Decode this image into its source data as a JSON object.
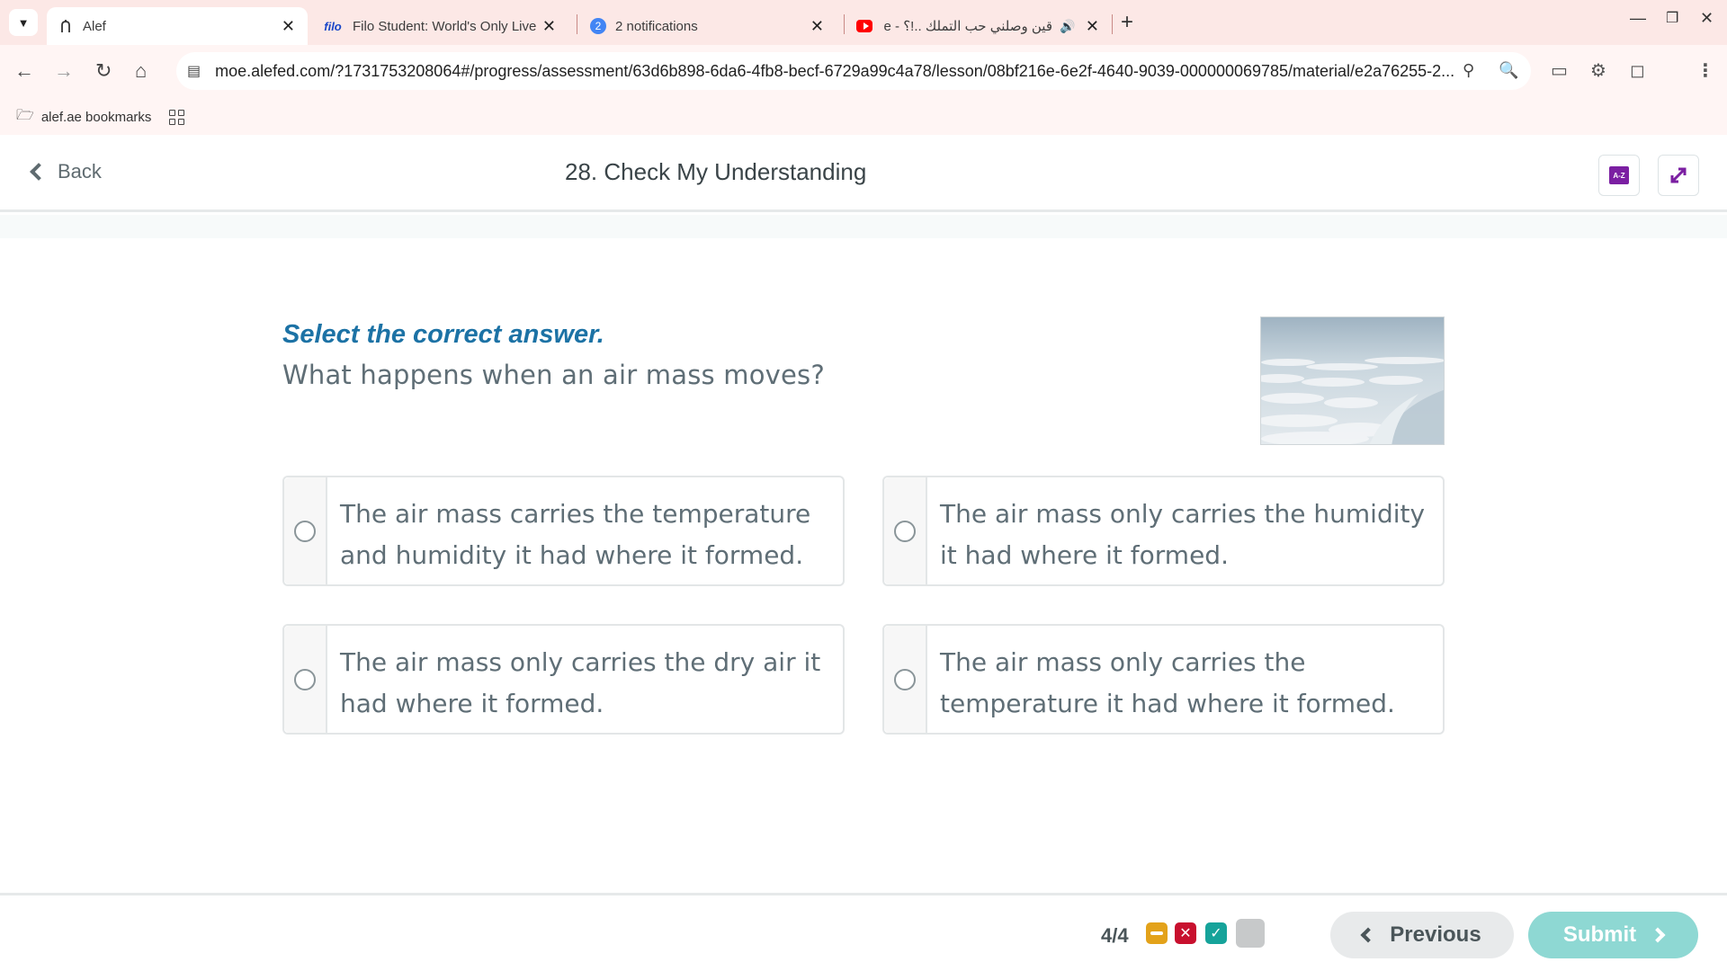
{
  "browser": {
    "tabs": [
      {
        "title": "Alef",
        "active": true,
        "icon": "alef-icon"
      },
      {
        "title": "Filo Student: World's Only Live I",
        "active": false,
        "icon": "filo-icon",
        "icon_text": "filo"
      },
      {
        "title": "2 notifications",
        "active": false,
        "icon": "notification-badge-icon",
        "badge": "2"
      },
      {
        "title": "قين وصلني حب التملك ..!؟ - e",
        "active": false,
        "icon": "youtube-icon"
      }
    ],
    "url": "moe.alefed.com/?1731753208064#/progress/assessment/63d6b898-6da6-4fb8-becf-6729a99c4a78/lesson/08bf216e-6e2f-4640-9039-000000069785/material/e2a76255-2...",
    "bookmarks": [
      {
        "label": "alef.ae bookmarks",
        "icon": "folder-icon"
      }
    ]
  },
  "header": {
    "back_label": "Back",
    "title": "28. Check My Understanding",
    "glossary_icon_text": "A-Z"
  },
  "question": {
    "instruction": "Select the correct answer.",
    "text": "What happens when an air mass moves?",
    "image": "clouds-aerial-image",
    "options": [
      {
        "line1": "The air mass carries the temperature",
        "line2": "and humidity it had where it formed."
      },
      {
        "line1": "The air mass only carries the humidity",
        "line2": "it had where it formed."
      },
      {
        "line1": "The air mass only carries the dry air it",
        "line2": "had where it formed."
      },
      {
        "line1": "The air mass only carries the",
        "line2": "temperature it had where it formed."
      }
    ]
  },
  "footer": {
    "progress": "4/4",
    "status_chips": [
      "skipped",
      "incorrect",
      "correct",
      "unanswered"
    ],
    "previous_label": "Previous",
    "submit_label": "Submit"
  },
  "colors": {
    "instruction": "#1c72a5",
    "submit": "#8ed8d3",
    "skip_chip": "#e3a21a",
    "wrong_chip": "#c8102e",
    "right_chip": "#16a39a",
    "accent_purple": "#7b1fa2"
  }
}
